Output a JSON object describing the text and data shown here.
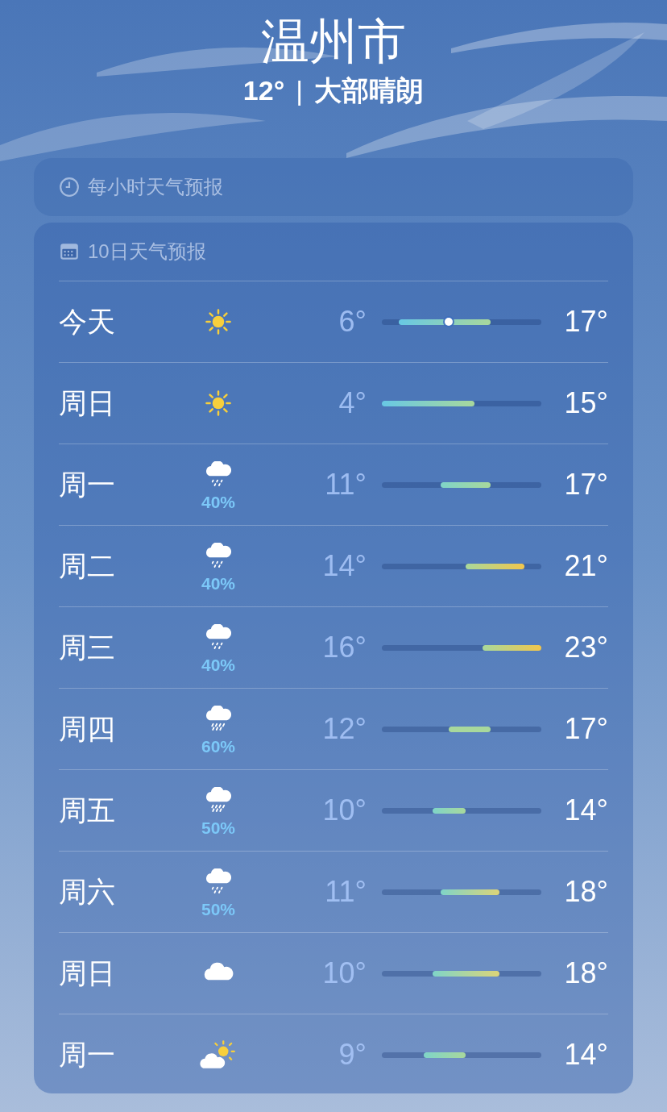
{
  "location": {
    "city": "温州市",
    "temp": "12°",
    "separator": "|",
    "condition": "大部晴朗"
  },
  "hourly": {
    "title": "每小时天气预报"
  },
  "forecast": {
    "title": "10日天气预报",
    "days": [
      {
        "day": "今天",
        "kind": "sun",
        "low": "6°",
        "high": "17°",
        "current_marker": true
      },
      {
        "day": "周日",
        "kind": "sun",
        "low": "4°",
        "high": "15°",
        "current_marker": false
      },
      {
        "day": "周一",
        "kind": "drizzle",
        "precip": "40%",
        "low": "11°",
        "high": "17°",
        "current_marker": false
      },
      {
        "day": "周二",
        "kind": "drizzle",
        "precip": "40%",
        "low": "14°",
        "high": "21°",
        "current_marker": false
      },
      {
        "day": "周三",
        "kind": "drizzle",
        "precip": "40%",
        "low": "16°",
        "high": "23°",
        "current_marker": false
      },
      {
        "day": "周四",
        "kind": "rain",
        "precip": "60%",
        "low": "12°",
        "high": "17°",
        "current_marker": false
      },
      {
        "day": "周五",
        "kind": "rain",
        "precip": "50%",
        "low": "10°",
        "high": "14°",
        "current_marker": false
      },
      {
        "day": "周六",
        "kind": "drizzle",
        "precip": "50%",
        "low": "11°",
        "high": "18°",
        "current_marker": false
      },
      {
        "day": "周日",
        "kind": "cloud",
        "low": "10°",
        "high": "18°",
        "current_marker": false
      },
      {
        "day": "周一",
        "kind": "partly-cloudy",
        "low": "9°",
        "high": "14°",
        "current_marker": false
      }
    ]
  }
}
